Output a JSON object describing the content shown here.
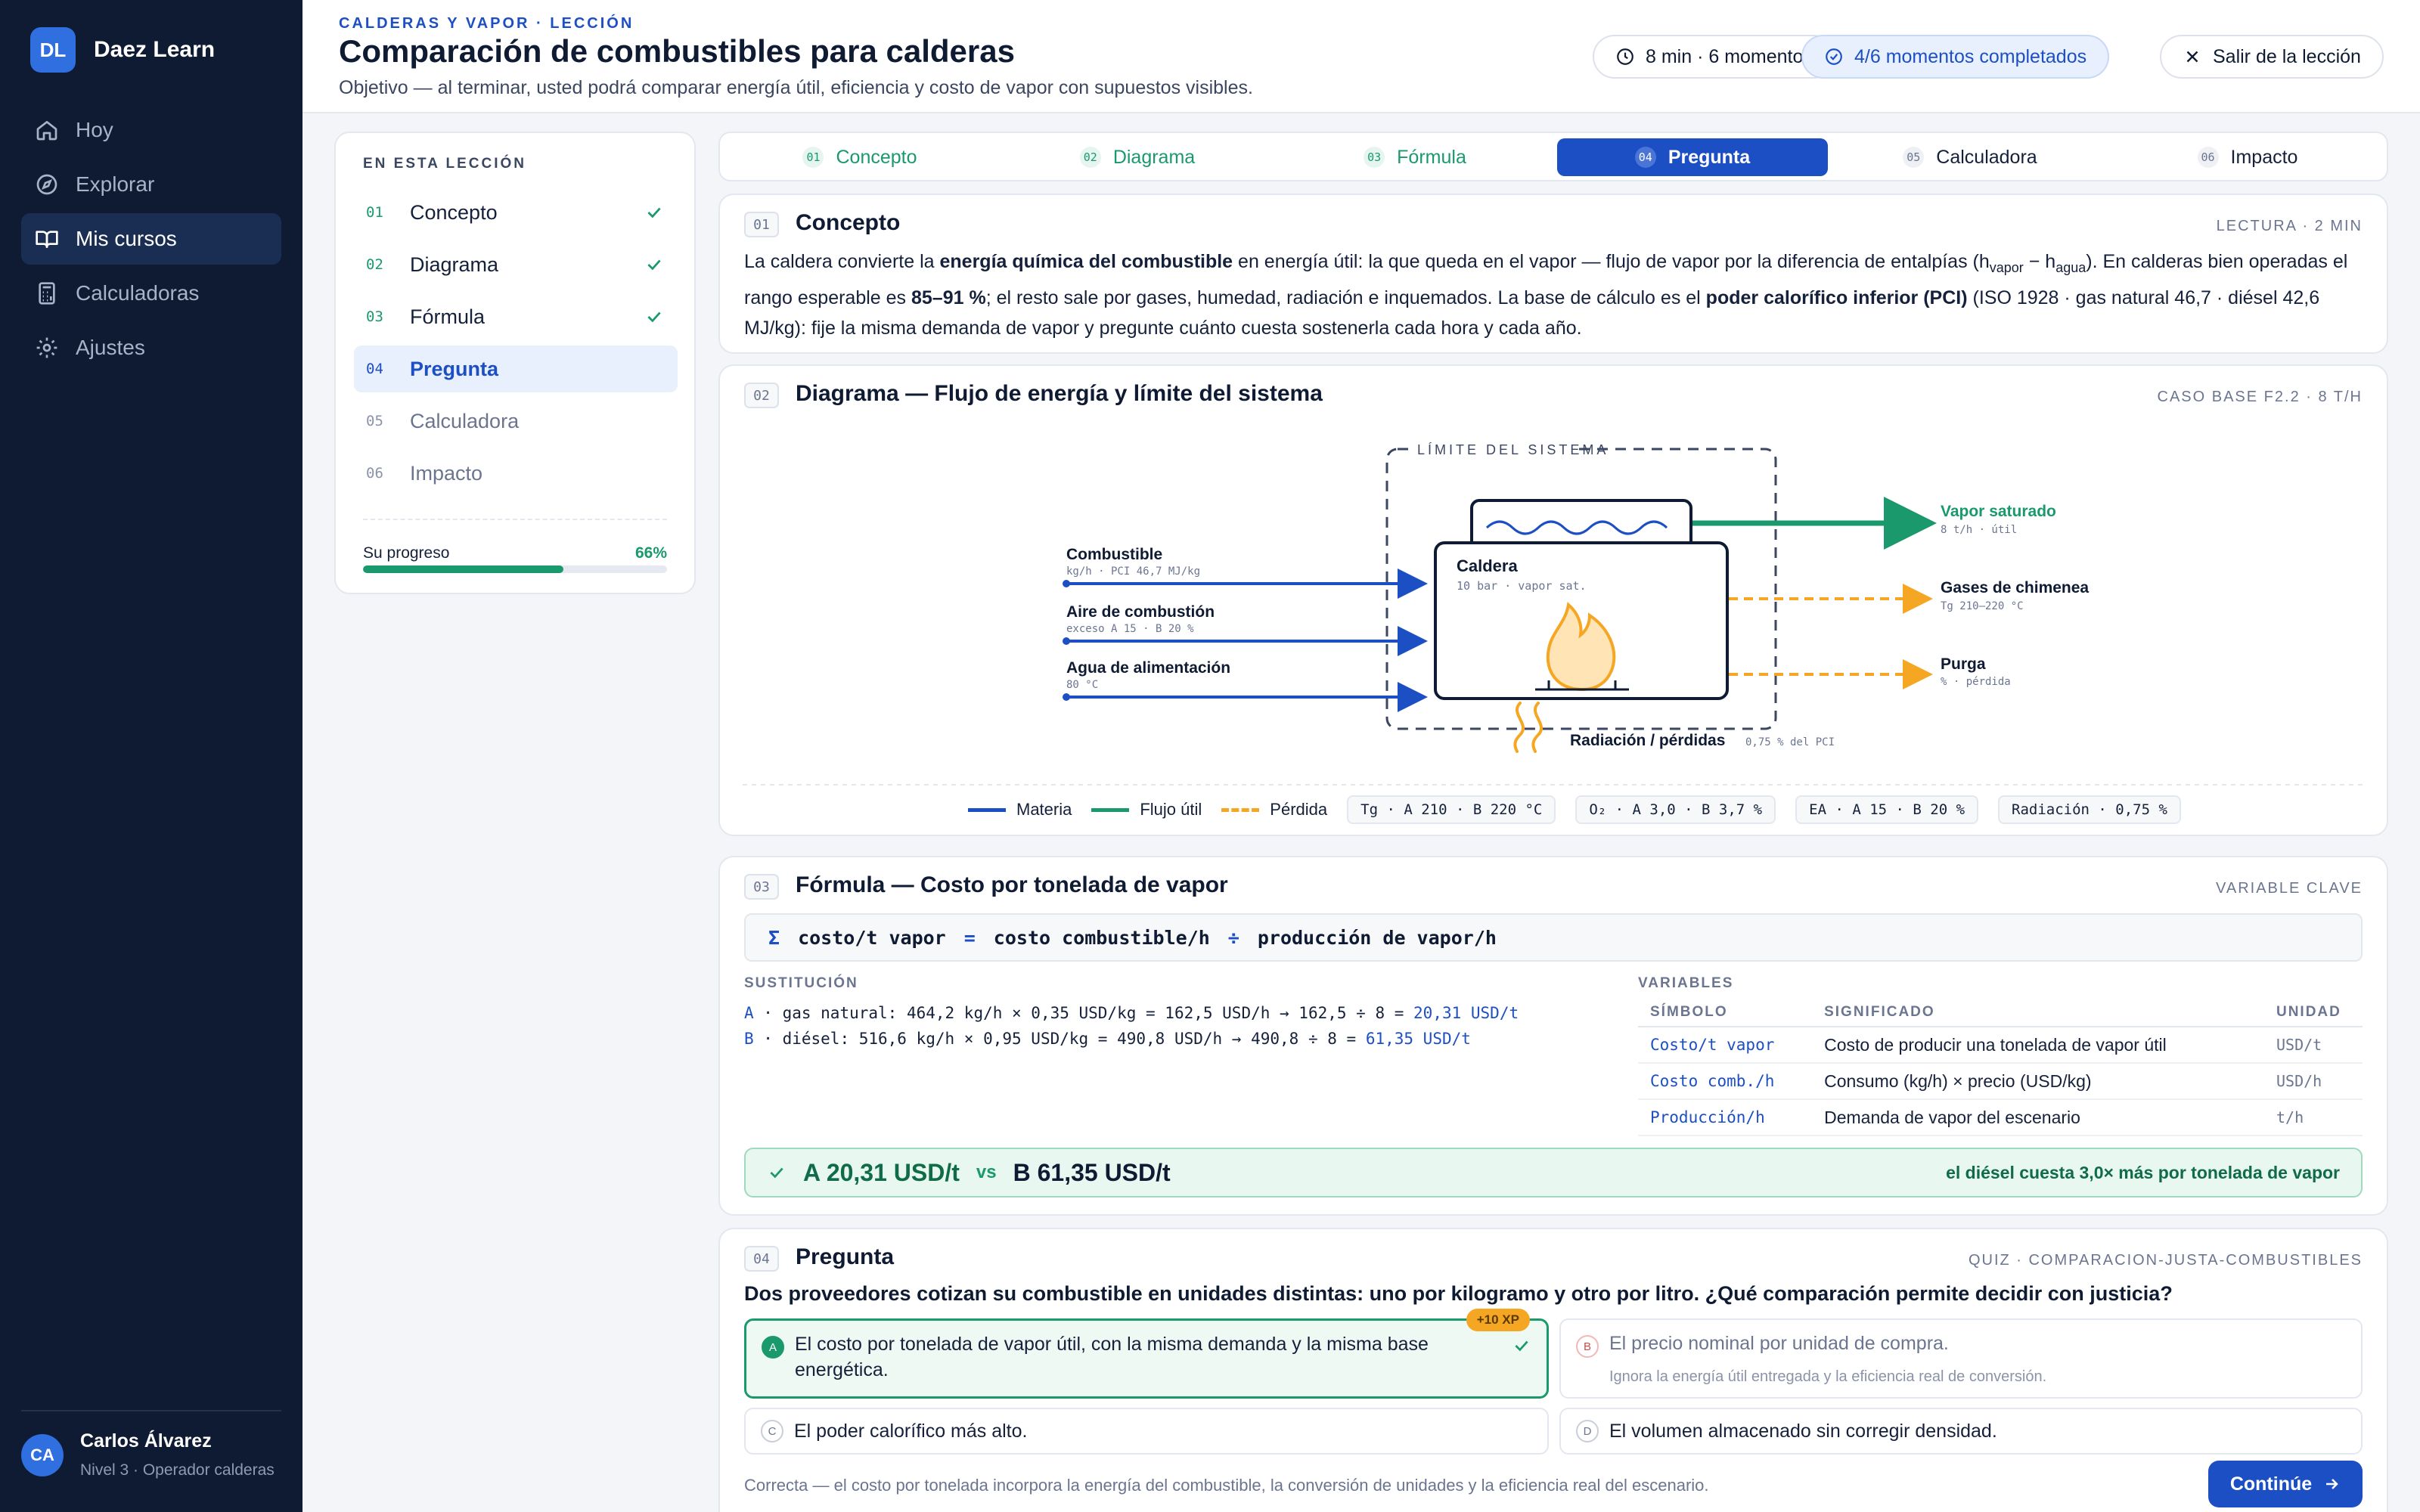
{
  "brand": {
    "initials": "DL",
    "name": "Daez Learn"
  },
  "nav": [
    {
      "label": "Hoy",
      "icon": "home-icon"
    },
    {
      "label": "Explorar",
      "icon": "compass-icon"
    },
    {
      "label": "Mis cursos",
      "icon": "book-icon",
      "active": true
    },
    {
      "label": "Calculadoras",
      "icon": "calculator-icon"
    },
    {
      "label": "Ajustes",
      "icon": "gear-icon"
    }
  ],
  "user": {
    "initials": "CA",
    "name": "Carlos Álvarez",
    "level": "Nivel 3 · Operador calderas"
  },
  "header": {
    "kicker": "CALDERAS Y VAPOR · LECCIÓN",
    "title": "Comparación de combustibles para calderas",
    "objective": "Objetivo — al terminar, usted podrá comparar energía útil, eficiencia y costo de vapor con supuestos visibles.",
    "duration": "8 min · 6 momentos",
    "completed": "4/6 momentos completados",
    "exit": "Salir de la lección"
  },
  "toc": {
    "heading": "EN ESTA LECCIÓN",
    "items": [
      {
        "num": "01",
        "label": "Concepto",
        "state": "done"
      },
      {
        "num": "02",
        "label": "Diagrama",
        "state": "done"
      },
      {
        "num": "03",
        "label": "Fórmula",
        "state": "done"
      },
      {
        "num": "04",
        "label": "Pregunta",
        "state": "current"
      },
      {
        "num": "05",
        "label": "Calculadora",
        "state": "pending"
      },
      {
        "num": "06",
        "label": "Impacto",
        "state": "pending"
      }
    ],
    "progress_label": "Su progreso",
    "progress_value": "66%",
    "progress_fraction": 0.66
  },
  "tabs": [
    {
      "num": "01",
      "label": "Concepto",
      "state": "done"
    },
    {
      "num": "02",
      "label": "Diagrama",
      "state": "done"
    },
    {
      "num": "03",
      "label": "Fórmula",
      "state": "done"
    },
    {
      "num": "04",
      "label": "Pregunta",
      "state": "active"
    },
    {
      "num": "05",
      "label": "Calculadora",
      "state": "pending"
    },
    {
      "num": "06",
      "label": "Impacto",
      "state": "pending"
    }
  ],
  "concept": {
    "num": "01",
    "title": "Concepto",
    "meta": "LECTURA · 2 MIN",
    "p1": "La caldera convierte la ",
    "b1": "energía química del combustible",
    "p2": " en energía útil: la que queda en el vapor — flujo de vapor por la diferencia de entalpías (h",
    "sub1": "vapor",
    "p3": " − h",
    "sub2": "agua",
    "p4": "). En calderas bien operadas el rango esperable es ",
    "b2": "85–91 %",
    "p5": "; el resto sale por gases, humedad, radiación e inquemados. La base de cálculo es el ",
    "b3": "poder calorífico inferior (PCI)",
    "p6": " (ISO 1928 · gas natural 46,7 · diésel 42,6 MJ/kg): fije la misma demanda de vapor y pregunte cuánto cuesta sostenerla cada hora y cada año."
  },
  "diagram": {
    "num": "02",
    "title": "Diagrama — Flujo de energía y límite del sistema",
    "meta": "CASO BASE F2.2 · 8 T/H",
    "boundary": "LÍMITE DEL SISTEMA",
    "boiler": {
      "name": "Caldera",
      "detail": "10 bar · vapor sat."
    },
    "inputs": [
      {
        "name": "Combustible",
        "detail": "kg/h · PCI 46,7 MJ/kg"
      },
      {
        "name": "Aire de combustión",
        "detail": "exceso A 15 · B 20 %"
      },
      {
        "name": "Agua de alimentación",
        "detail": "80 °C"
      }
    ],
    "steam": {
      "name": "Vapor saturado",
      "detail": "8 t/h · útil"
    },
    "losses": [
      {
        "name": "Gases de chimenea",
        "detail": "Tg 210–220 °C"
      },
      {
        "name": "Purga",
        "detail": "% · pérdida"
      }
    ],
    "radiation": {
      "name": "Radiación / pérdidas",
      "detail": "0,75 % del PCI"
    },
    "legend": {
      "materia": "Materia",
      "util": "Flujo útil",
      "perdida": "Pérdida"
    },
    "chips": [
      "Tg · A 210 · B 220 °C",
      "O₂ · A 3,0 · B 3,7 %",
      "EA · A 15 · B 20 %",
      "Radiación · 0,75 %"
    ],
    "colors": {
      "materia": "#1d4fc4",
      "util": "#1a9a6c",
      "perdida": "#f5a623"
    }
  },
  "formula": {
    "num": "03",
    "title": "Fórmula — Costo por tonelada de vapor",
    "meta": "VARIABLE CLAVE",
    "sigma": "Σ",
    "lhs": "costo/t vapor",
    "eq": "=",
    "num_term": "costo combustible/h",
    "div": "÷",
    "den_term": "producción de vapor/h",
    "subst_label": "SUSTITUCIÓN",
    "lineA": {
      "key": "A",
      "text": " · gas natural: 464,2 kg/h × 0,35 USD/kg = 162,5 USD/h → 162,5 ÷ 8 = ",
      "result": "20,31 USD/t"
    },
    "lineB": {
      "key": "B",
      "text": " · diésel: 516,6 kg/h × 0,95 USD/kg = 490,8 USD/h → 490,8 ÷ 8 = ",
      "result": "61,35 USD/t"
    },
    "vars_label": "VARIABLES",
    "columns": [
      "SÍMBOLO",
      "SIGNIFICADO",
      "UNIDAD"
    ],
    "rows": [
      {
        "sym": "Costo/t vapor",
        "meaning": "Costo de producir una tonelada de vapor útil",
        "unit": "USD/t"
      },
      {
        "sym": "Costo comb./h",
        "meaning": "Consumo (kg/h) × precio (USD/kg)",
        "unit": "USD/h"
      },
      {
        "sym": "Producción/h",
        "meaning": "Demanda de vapor del escenario",
        "unit": "t/h"
      }
    ],
    "result": {
      "a": "A 20,31 USD/t",
      "vs": "vs",
      "b": "B 61,35 USD/t",
      "note": "el diésel cuesta 3,0× más por tonelada de vapor"
    }
  },
  "quiz": {
    "num": "04",
    "title": "Pregunta",
    "meta": "QUIZ · COMPARACION-JUSTA-COMBUSTIBLES",
    "question": "Dos proveedores cotizan su combustible en unidades distintas: uno por kilogramo y otro por litro. ¿Qué comparación permite decidir con justicia?",
    "options": [
      {
        "letter": "A",
        "text": "El costo por tonelada de vapor útil, con la misma demanda y la misma base energética.",
        "state": "correct",
        "xp": "+10 XP"
      },
      {
        "letter": "B",
        "text": "El precio nominal por unidad de compra.",
        "hint": "Ignora la energía útil entregada y la eficiencia real de conversión.",
        "state": "wrong"
      },
      {
        "letter": "C",
        "text": "El poder calorífico más alto.",
        "state": "neutral"
      },
      {
        "letter": "D",
        "text": "El volumen almacenado sin corregir densidad.",
        "state": "neutral"
      }
    ],
    "feedback": "Correcta — el costo por tonelada incorpora la energía del combustible, la conversión de unidades y la eficiencia real del escenario.",
    "cta": "Continúe"
  }
}
